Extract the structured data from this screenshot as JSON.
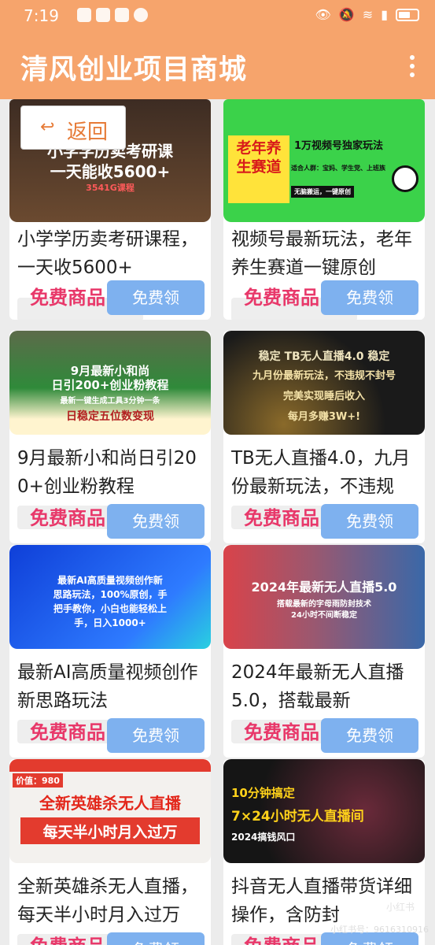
{
  "status_bar": {
    "time": "7:19"
  },
  "app": {
    "title": "清风创业项目商城"
  },
  "back": {
    "label": "返回",
    "arrow": "↩"
  },
  "cards": [
    {
      "title": "小学学历卖考研课程，一天收5600+",
      "thumb_lines": [
        "小学学历卖考研课",
        "一天能收5600+",
        "3541G课程"
      ],
      "free_label": "免费商品",
      "button": "免费领"
    },
    {
      "title": "视频号最新玩法，老年养生赛道一键原创",
      "thumb_lines": [
        "老年养生赛道",
        "1万视频号独家玩法",
        "适合人群：宝妈、学生党、上班族",
        "无脑搬运，一键原创"
      ],
      "free_label": "免费商品",
      "button": "免费领"
    },
    {
      "title": "9月最新小和尚日引200+创业粉教程",
      "thumb_lines": [
        "9月最新小和尚",
        "日引200+创业粉教程",
        "最新一键生成工具3分钟一条",
        "日稳定五位数变现"
      ],
      "free_label": "免费商品",
      "button": "免费领"
    },
    {
      "title": "TB无人直播4.0，九月份最新玩法，不违规",
      "thumb_lines": [
        "稳定 TB无人直播4.0 稳定",
        "九月份最新玩法，不违规不封号",
        "完美实现睡后收入",
        "每月多赚3W+!"
      ],
      "free_label": "免费商品",
      "button": "免费领"
    },
    {
      "title": "最新AI高质量视频创作新思路玩法",
      "thumb_lines": [
        "最新AI高质量视频创作新",
        "思路玩法，100%原创，手",
        "把手教你，小白也能轻松上",
        "手，日入1000+"
      ],
      "free_label": "免费商品",
      "button": "免费领"
    },
    {
      "title": "2024年最新无人直播5.0，搭载最新",
      "thumb_lines": [
        "2024年最新无人直播5.0",
        "搭载最新的字母雨防封技术",
        "24小时不间断稳定"
      ],
      "free_label": "免费商品",
      "button": "免费领"
    },
    {
      "title": "全新英雄杀无人直播，每天半小时月入过万",
      "thumb_lines": [
        "价值：980",
        "全新英雄杀无人直播",
        "每天半小时月入过万"
      ],
      "free_label": "免费商品",
      "button": "免费领"
    },
    {
      "title": "抖音无人直播带货详细操作，含防封",
      "thumb_lines": [
        "10分钟搞定",
        "7×24小时无人直播间",
        "2024搞钱风口"
      ],
      "free_label": "免费商品",
      "button": "免费领"
    }
  ],
  "watermark": {
    "text": "小红书号：9616310916",
    "logo": "小红书"
  }
}
